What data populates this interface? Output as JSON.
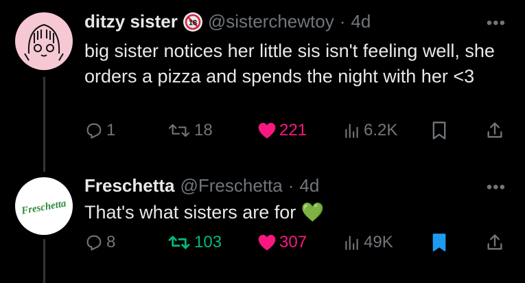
{
  "tweets": [
    {
      "name": "ditzy sister",
      "handle": "@sisterchewtoy",
      "separator": "·",
      "time": "4d",
      "text": "big sister notices her little sis isn't feeling well, she orders a pizza and spends the night with her <3",
      "badge": "18",
      "replies": "1",
      "retweets": "18",
      "likes": "221",
      "views": "6.2K",
      "liked": true,
      "retweeted": false,
      "bookmarked": false
    },
    {
      "name": "Freschetta",
      "handle": "@Freschetta",
      "separator": "·",
      "time": "4d",
      "text": "That's what sisters are for 💚",
      "avatar_text": "Freschetta",
      "replies": "8",
      "retweets": "103",
      "likes": "307",
      "views": "49K",
      "liked": true,
      "retweeted": true,
      "bookmarked": true
    }
  ],
  "more_label": "•••",
  "colors": {
    "like": "#f91880",
    "retweet": "#00ba7c",
    "bookmark": "#1d9bf0",
    "muted": "#71767b",
    "text": "#e7e9ea"
  }
}
